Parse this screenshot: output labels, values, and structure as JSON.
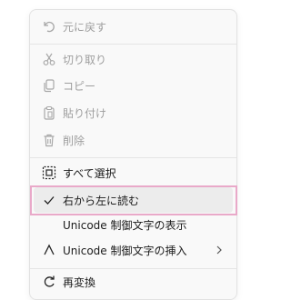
{
  "menu": {
    "items": [
      {
        "label": "元に戻す",
        "icon": "undo-icon",
        "enabled": false
      },
      {
        "label": "切り取り",
        "icon": "scissors-icon",
        "enabled": false
      },
      {
        "label": "コピー",
        "icon": "copy-icon",
        "enabled": false
      },
      {
        "label": "貼り付け",
        "icon": "paste-icon",
        "enabled": false
      },
      {
        "label": "削除",
        "icon": "trash-icon",
        "enabled": false
      },
      {
        "label": "すべて選択",
        "icon": "select-all-icon",
        "enabled": true
      },
      {
        "label": "右から左に読む",
        "icon": "checkmark-icon",
        "enabled": true,
        "checked": true
      },
      {
        "label": "Unicode 制御文字の表示",
        "icon": "",
        "enabled": true
      },
      {
        "label": "Unicode 制御文字の挿入",
        "icon": "caret-icon",
        "enabled": true,
        "submenu": true
      },
      {
        "label": "再変換",
        "icon": "reconvert-icon",
        "enabled": true
      }
    ]
  },
  "colors": {
    "highlight_border": "#e9a9c9",
    "disabled_text": "#9e9e9e",
    "enabled_text": "#1b1b1b",
    "hover_bg": "#ececec"
  }
}
